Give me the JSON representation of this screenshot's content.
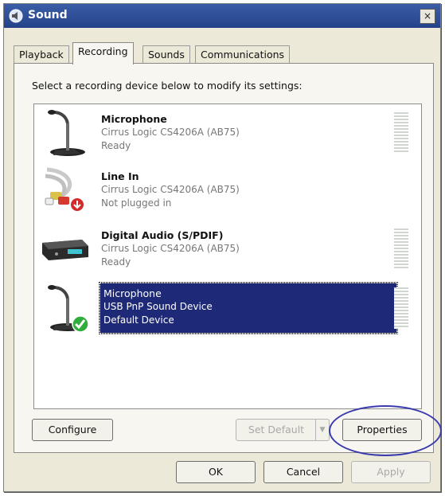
{
  "window": {
    "title": "Sound",
    "close_label": "×"
  },
  "tabs": [
    {
      "label": "Playback"
    },
    {
      "label": "Recording"
    },
    {
      "label": "Sounds"
    },
    {
      "label": "Communications"
    }
  ],
  "instructions": "Select a recording device below to modify its settings:",
  "devices": [
    {
      "name": "Microphone",
      "description": "Cirrus Logic CS4206A (AB75)",
      "status": "Ready",
      "icon": "microphone-icon"
    },
    {
      "name": "Line In",
      "description": "Cirrus Logic CS4206A (AB75)",
      "status": "Not plugged in",
      "icon": "rca-cable-icon"
    },
    {
      "name": "Digital Audio (S/PDIF)",
      "description": "Cirrus Logic CS4206A (AB75)",
      "status": "Ready",
      "icon": "audio-receiver-icon"
    },
    {
      "name": "Microphone",
      "description": "USB PnP Sound Device",
      "status": "Default Device",
      "icon": "microphone-icon",
      "selected": true
    }
  ],
  "buttons": {
    "configure": "Configure",
    "set_default": "Set Default",
    "properties": "Properties",
    "ok": "OK",
    "cancel": "Cancel",
    "apply": "Apply"
  },
  "colors": {
    "selection": "#1e2a78",
    "titlebar": "#24428a",
    "highlight_circle": "#3a3ab0",
    "check": "#2fae3c",
    "unplugged": "#d22b2b"
  }
}
